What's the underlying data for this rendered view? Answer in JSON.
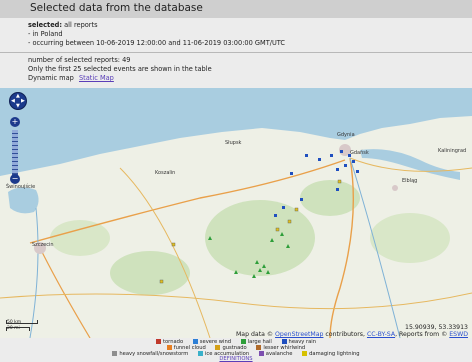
{
  "header": {
    "title": "Selected data from the database"
  },
  "selection": {
    "label": "selected:",
    "value": "all reports",
    "line2": "- in Poland",
    "line3": "- occurring between 10-06-2019 12:00:00 and 11-06-2019 03:00:00 GMT/UTC"
  },
  "info": {
    "count": "number of selected reports: 49",
    "note": "Only the first 25 selected events are shown in the table",
    "dynamic": "Dynamic map",
    "static": "Static Map"
  },
  "map": {
    "places": [
      {
        "name": "Gdańsk"
      },
      {
        "name": "Gdynia"
      },
      {
        "name": "Słupsk"
      },
      {
        "name": "Koszalin"
      },
      {
        "name": "Elbląg"
      },
      {
        "name": "Szczecin"
      },
      {
        "name": "Kaliningrad"
      },
      {
        "name": "Świnoujście"
      }
    ],
    "coords": "15.90939, 53.33913",
    "attribution": {
      "prefix": "Map data ©",
      "osm": "OpenStreetMap",
      "mid": "contributors,",
      "license": "CC-BY-SA",
      "reports": ", Reports from ©",
      "eswd": "ESWD"
    },
    "scale": {
      "top": "50 km",
      "bottom": "20 mi"
    },
    "controls": {
      "zoom_in": "+",
      "zoom_out": "−"
    }
  },
  "legend": {
    "row1": [
      {
        "label": "tornado",
        "color": "#c0392b",
        "icon": "tornado-icon"
      },
      {
        "label": "severe wind",
        "color": "#2d7fd6",
        "icon": "severe-wind-icon"
      },
      {
        "label": "large hail",
        "color": "#2e9e3a",
        "icon": "large-hail-icon"
      },
      {
        "label": "heavy rain",
        "color": "#1f4fbf",
        "icon": "heavy-rain-icon"
      }
    ],
    "row2": [
      {
        "label": "funnel cloud",
        "color": "#e67e22",
        "icon": "funnel-cloud-icon"
      },
      {
        "label": "gustnado",
        "color": "#d4a017",
        "icon": "gustnado-icon"
      },
      {
        "label": "lesser whirlwind",
        "color": "#b06a2a",
        "icon": "lesser-whirlwind-icon"
      }
    ],
    "row3": [
      {
        "label": "heavy snowfall/snowstorm",
        "color": "#8e8e8e",
        "icon": "snowfall-icon"
      },
      {
        "label": "ice accumulation",
        "color": "#3ab0c9",
        "icon": "ice-icon"
      },
      {
        "label": "avalanche",
        "color": "#7d4fb0",
        "icon": "avalanche-icon"
      },
      {
        "label": "damaging lightning",
        "color": "#d6c100",
        "icon": "lightning-icon"
      }
    ],
    "definitions": "DEFINITIONS"
  },
  "colors": {
    "sea": "#a9cde0",
    "land": "#eef0e6",
    "forest": "#cfe2bd",
    "road": "#e9a04a",
    "marker_blue": "#1f4fbf",
    "marker_green": "#2e9e3a",
    "marker_yellow": "#e0c020"
  }
}
